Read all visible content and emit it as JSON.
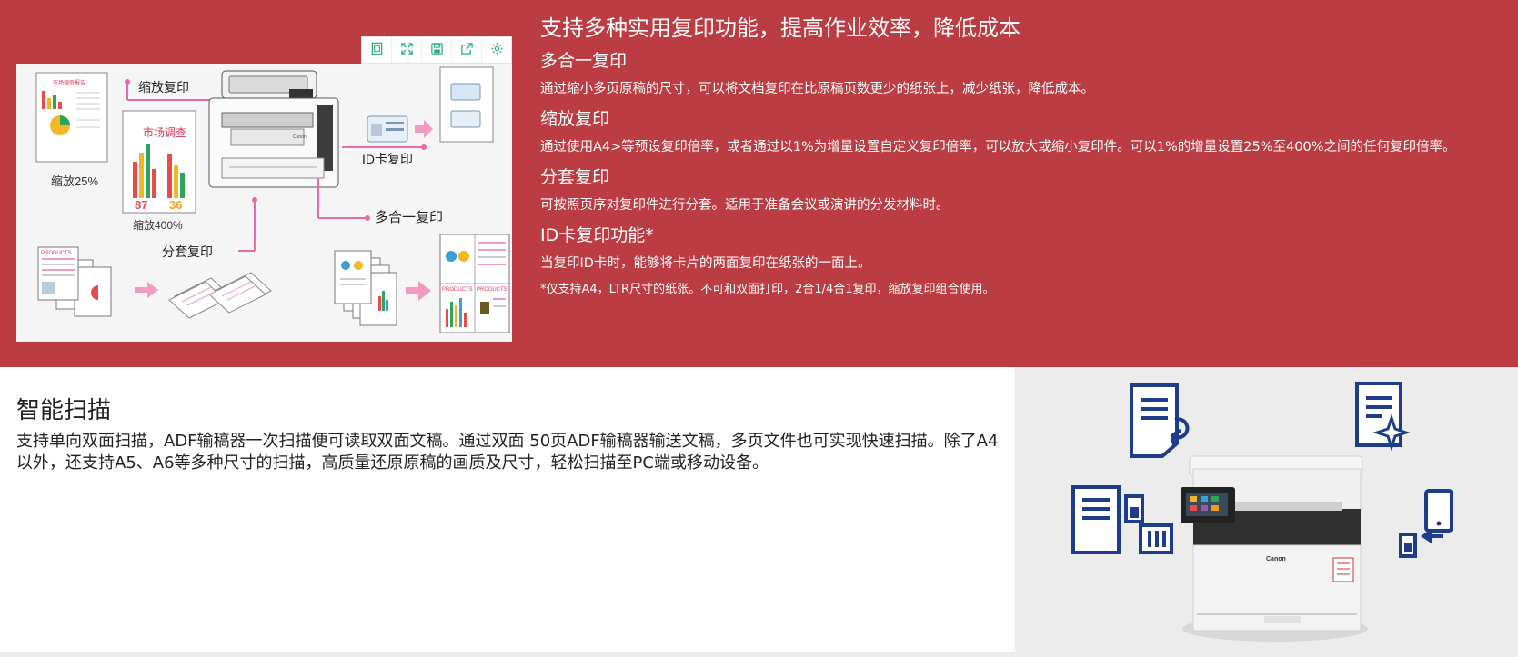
{
  "toolbar": {
    "icons": [
      "frame-icon",
      "expand-icon",
      "save-icon",
      "share-icon",
      "gear-icon"
    ]
  },
  "copy_illustration": {
    "labels": {
      "zoom_copy": "缩放复印",
      "market_survey": "市场调查",
      "doc_heading": "市场调查报告",
      "zoom_25": "缩放25%",
      "zoom_400": "缩放400%",
      "pct_87": "87",
      "pct_36": "36",
      "id_card_copy": "ID卡复印",
      "nup_copy": "多合一复印",
      "collate_copy": "分套复印",
      "products": "PRODUCTS",
      "canon": "Canon"
    }
  },
  "copy_section": {
    "title": "支持多种实用复印功能，提高作业效率，降低成本",
    "items": [
      {
        "heading": "多合一复印",
        "text": "通过缩小多页原稿的尺寸，可以将文档复印在比原稿页数更少的纸张上，减少纸张，降低成本。"
      },
      {
        "heading": "缩放复印",
        "text": "通过使用A4>等预设复印倍率，或者通过以1%为增量设置自定义复印倍率，可以放大或缩小复印件。可以1%的增量设置25%至400%之间的任何复印倍率。"
      },
      {
        "heading": "分套复印",
        "text": "可按照页序对复印件进行分套。适用于准备会议或演讲的分发材料时。"
      },
      {
        "heading": "ID卡复印功能*",
        "text": "当复印ID卡时，能够将卡片的两面复印在纸张的一面上。"
      }
    ],
    "note": "*仅支持A4，LTR尺寸的纸张。不可和双面打印，2合1/4合1复印，缩放复印组合使用。"
  },
  "scan_section": {
    "title": "智能扫描",
    "description": "支持单向双面扫描，ADF输稿器一次扫描便可读取双面文稿。通过双面 50页ADF输稿器输送文稿，多页文件也可实现快速扫描。除了A4以外，还支持A5、A6等多种尺寸的扫描，高质量还原原稿的画质及尺寸，轻松扫描至PC端或移动设备。"
  },
  "scan_illustration": {
    "brand": "Canon",
    "icons": [
      "document-duplex-icon",
      "document-sparkle-icon",
      "document-to-storage-icon",
      "mobile-device-icon"
    ]
  },
  "colors": {
    "band_red": "#bb3c42",
    "icon_navy": "#1d3c8c",
    "accent_pink": "#e96aa6",
    "toolbar_green": "#2eae7c"
  }
}
